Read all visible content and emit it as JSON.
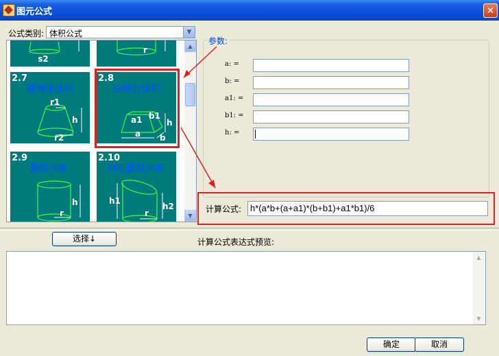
{
  "window": {
    "title": "图元公式",
    "close_glyph": "✕"
  },
  "category": {
    "label": "公式类别:",
    "value": "体积公式"
  },
  "tiles": [
    {
      "num": "",
      "name": ""
    },
    {
      "num": "",
      "name": ""
    },
    {
      "num": "2.7",
      "name": "圆锥体体积"
    },
    {
      "num": "2.8",
      "name": "四棱台体积"
    },
    {
      "num": "2.9",
      "name": "圆柱体积"
    },
    {
      "num": "2.10",
      "name": "斜切圆柱体积"
    }
  ],
  "tile_labels": {
    "t0": [
      "s2"
    ],
    "t1": [
      "r"
    ],
    "t2": [
      "r1",
      "h",
      "r2"
    ],
    "t3": [
      "a1",
      "b1",
      "h",
      "a",
      "b"
    ],
    "t4": [
      "h",
      "r"
    ],
    "t5": [
      "h1",
      "h2",
      "r"
    ]
  },
  "params": {
    "legend": "参数:",
    "items": [
      {
        "label": "a: =",
        "value": ""
      },
      {
        "label": "b: =",
        "value": ""
      },
      {
        "label": "a1: =",
        "value": ""
      },
      {
        "label": "b1: =",
        "value": ""
      },
      {
        "label": "h: =",
        "value": ""
      }
    ]
  },
  "formula": {
    "label": "计算公式:",
    "value": "h*(a*b+(a+a1)*(b+b1)+a1*b1)/6"
  },
  "select_button": "选择↓",
  "preview": {
    "label": "计算公式表达式预览:",
    "value": ""
  },
  "ok_button": "确定",
  "cancel_button": "取消",
  "colors": {
    "tile_bg": "#007a7a",
    "tile_name": "#0050ff",
    "highlight": "#e02020",
    "shape_line": "#3cff3c"
  }
}
